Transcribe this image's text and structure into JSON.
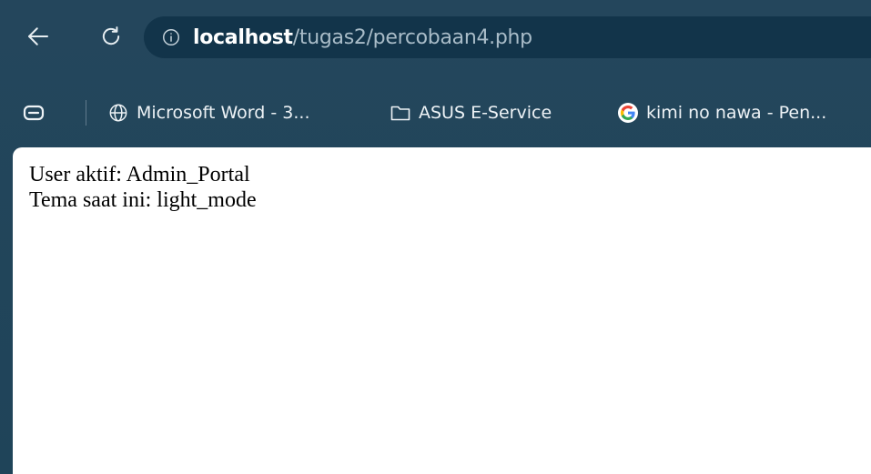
{
  "toolbar": {
    "back_icon": "arrow-left-icon",
    "reload_icon": "reload-icon",
    "site_info_icon": "info-circle-icon",
    "url_host": "localhost",
    "url_path": "/tugas2/percobaan4.php"
  },
  "bookmarks": {
    "tab_search_icon": "tab-search-icon",
    "items": [
      {
        "label": "Microsoft Word - 3...",
        "icon": "globe-icon"
      },
      {
        "label": "ASUS E-Service",
        "icon": "folder-icon"
      },
      {
        "label": "kimi no nawa - Pen...",
        "icon": "google-icon"
      }
    ]
  },
  "page": {
    "line1": "User aktif: Admin_Portal",
    "line2": "Tema saat ini: light_mode"
  },
  "colors": {
    "chrome_bg": "#24465c",
    "omnibox_bg": "#12344a",
    "page_bg": "#ffffff",
    "google_blue": "#4285F4",
    "google_red": "#EA4335",
    "google_yellow": "#FBBC05",
    "google_green": "#34A853"
  }
}
